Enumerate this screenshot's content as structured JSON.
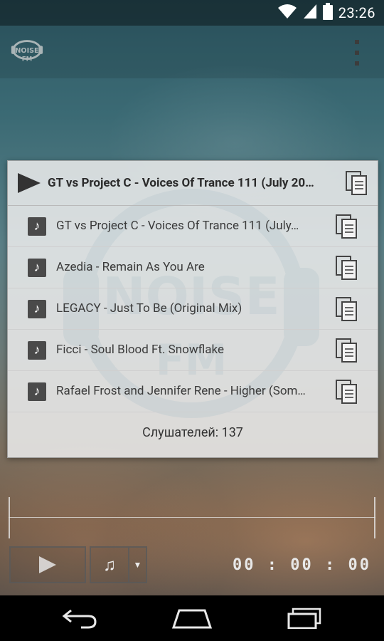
{
  "status_bar": {
    "time": "23:26",
    "icons": [
      "wifi-icon",
      "cell-signal-icon",
      "battery-icon"
    ]
  },
  "action_bar": {
    "logo_icon": "noise-fm-logo-icon",
    "overflow_icon": "overflow-menu-icon"
  },
  "dialog": {
    "now_playing": {
      "title": "GT vs Project C - Voices Of Trance 111 (July 20…",
      "play_icon": "play-icon",
      "copy_icon": "copy-icon"
    },
    "tracks": [
      {
        "title": "GT vs Project C - Voices Of Trance 111 (July…"
      },
      {
        "title": "Azedia - Remain As You Are"
      },
      {
        "title": "LEGACY - Just To Be (Original Mix)"
      },
      {
        "title": "Ficci - Soul Blood Ft. Snowflake"
      },
      {
        "title": "Rafael Frost and Jennifer Rene - Higher (Som…"
      }
    ],
    "listeners": "Слушателей: 137"
  },
  "player": {
    "timer": "00 : 00 : 00",
    "play_icon": "play-icon",
    "music_icon": "music-note-icon",
    "dropdown_icon": "dropdown-arrow-icon"
  },
  "nav_bar": {
    "icons": [
      "back-icon",
      "home-icon",
      "recent-apps-icon"
    ]
  },
  "colors": {
    "dialog_bg": "#ececec",
    "header_text": "#2b2b2b",
    "track_text": "#3a3a3a",
    "note_box": "#4a4a4a",
    "navbar": "#000000"
  }
}
